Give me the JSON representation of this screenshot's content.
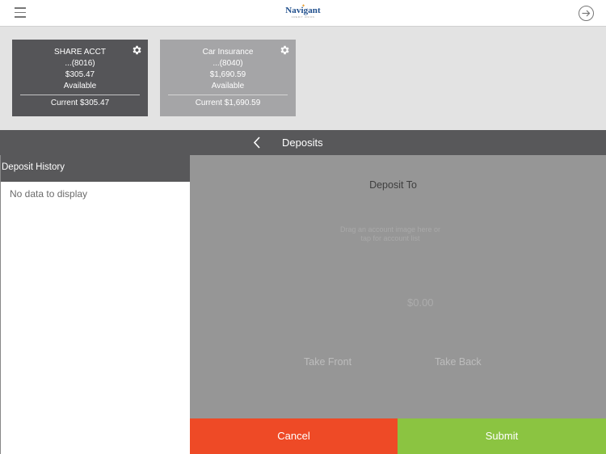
{
  "header": {
    "logo_text": "Navigant",
    "logo_subtext": "CREDIT UNION"
  },
  "accounts": [
    {
      "name": "SHARE ACCT",
      "number": "...(8016)",
      "balance": "$305.47",
      "balance_label": "Available",
      "current": "Current $305.47",
      "selected": true
    },
    {
      "name": "Car Insurance",
      "number": "...(8040)",
      "balance": "$1,690.59",
      "balance_label": "Available",
      "current": "Current $1,690.59",
      "selected": false
    }
  ],
  "deposits": {
    "title": "Deposits",
    "history_title": "Deposit History",
    "history_empty": "No data to display",
    "deposit_to_label": "Deposit To",
    "drag_hint_line1": "Drag an account image here or",
    "drag_hint_line2": "tap for account list",
    "amount": "$0.00",
    "take_front": "Take Front",
    "take_back": "Take Back",
    "cancel_label": "Cancel",
    "submit_label": "Submit"
  },
  "colors": {
    "cancel": "#ee4a26",
    "submit": "#8bc441",
    "header_bar": "#58585a",
    "selected_card": "#555558",
    "unselected_card": "#a5a5a7"
  }
}
